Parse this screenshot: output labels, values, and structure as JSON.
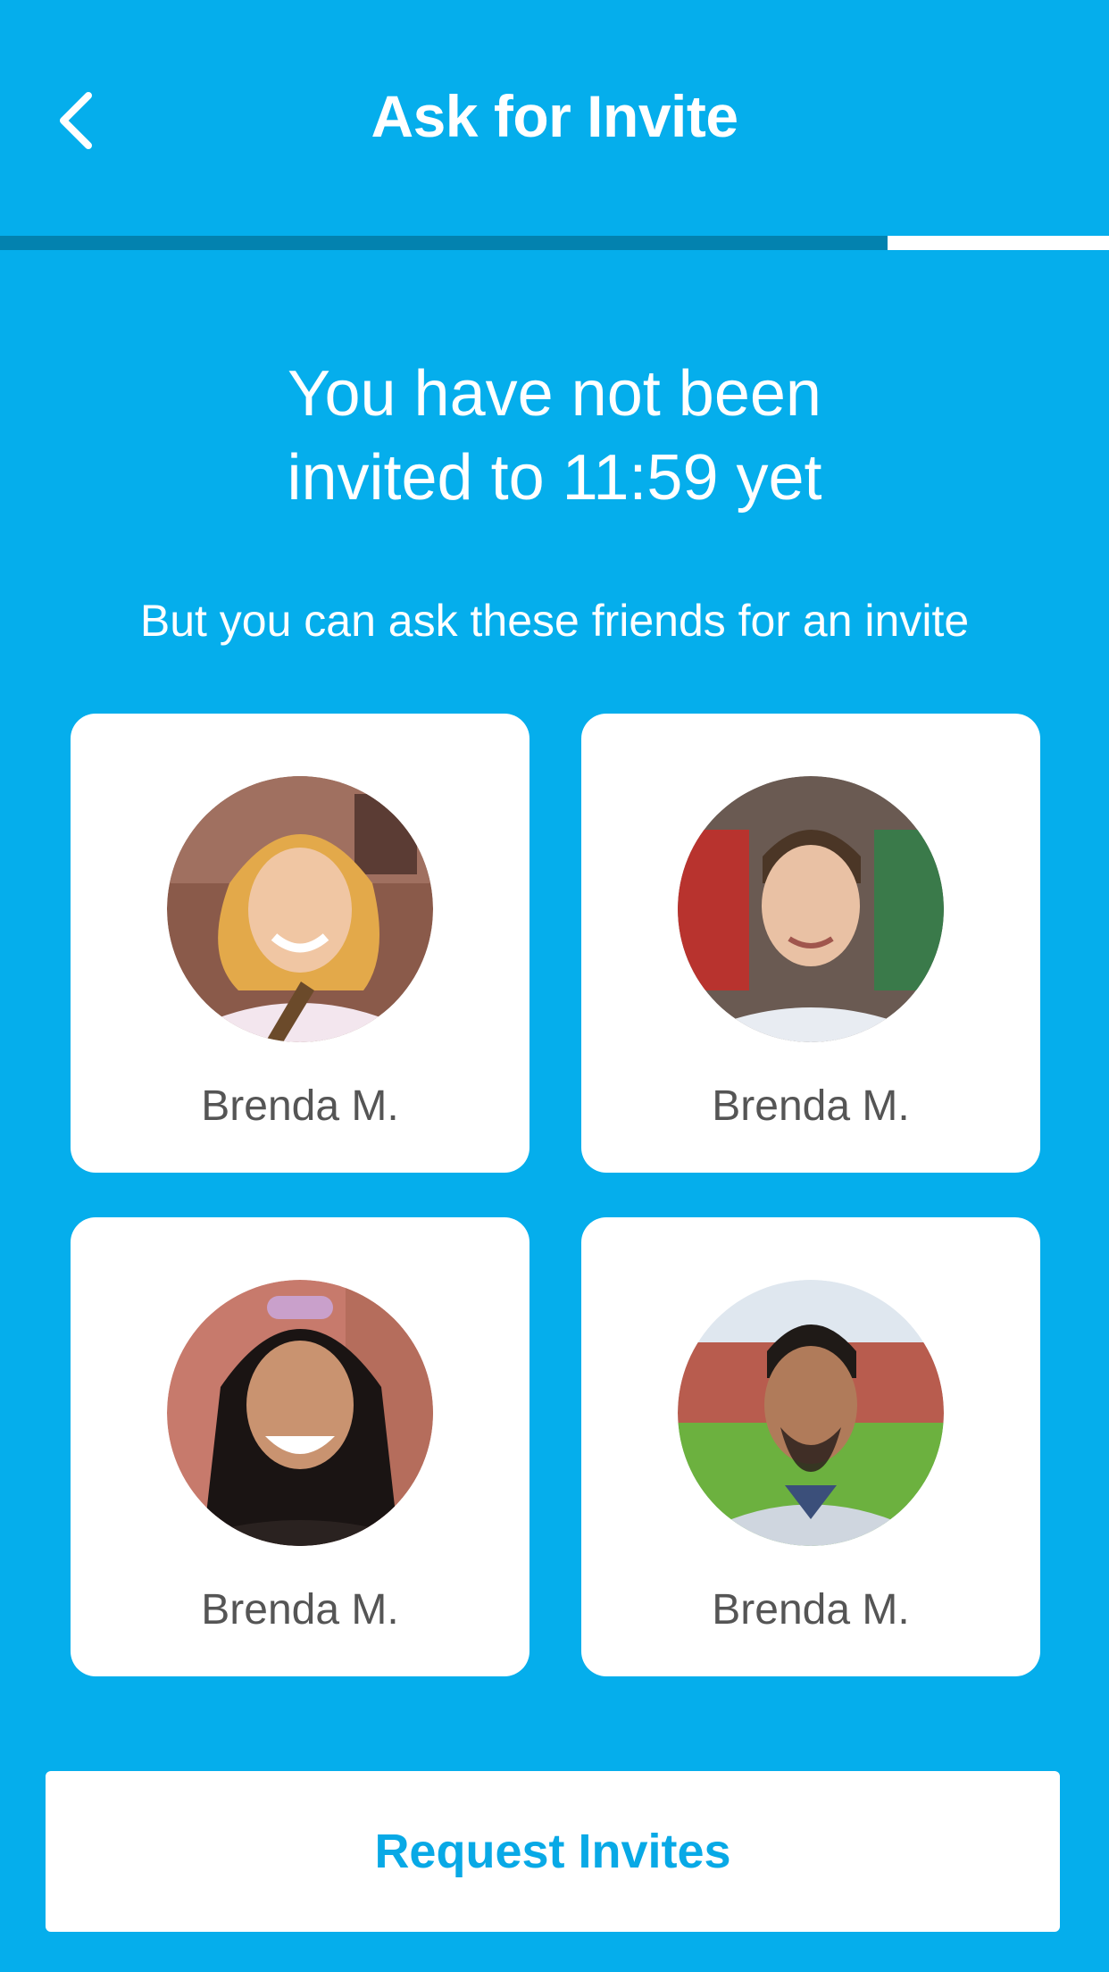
{
  "header": {
    "title": "Ask for Invite",
    "back_icon": "chevron-left-icon"
  },
  "progress": {
    "fraction": 0.8
  },
  "main": {
    "heading_line1": "You have not been",
    "heading_line2": "invited to 11:59 yet",
    "subtext": "But you can ask these friends for an invite"
  },
  "friends": [
    {
      "name": "Brenda M."
    },
    {
      "name": "Brenda M."
    },
    {
      "name": "Brenda M."
    },
    {
      "name": "Brenda M."
    }
  ],
  "cta": {
    "label": "Request Invites"
  },
  "colors": {
    "background": "#05AEEC",
    "progress_fill": "#0382AF",
    "progress_track": "#FFFFFF",
    "card": "#FFFFFF",
    "name_text": "#555555",
    "cta_text": "#08A9E6"
  }
}
